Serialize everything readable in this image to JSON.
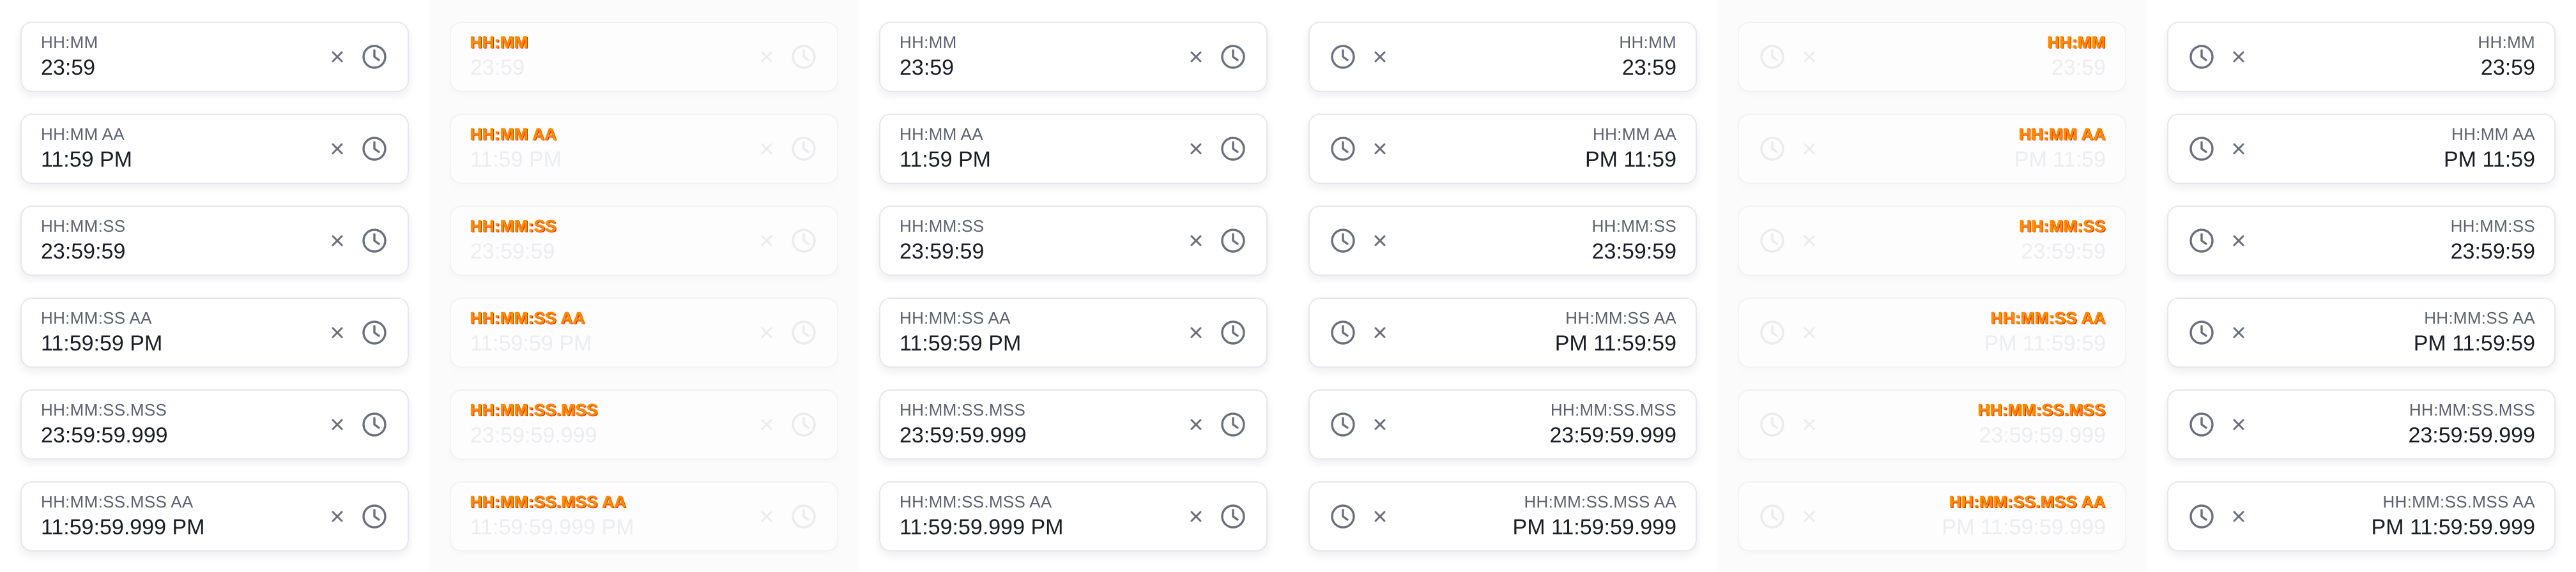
{
  "icons": {
    "clear": "close-icon",
    "time": "clock-icon"
  },
  "colors": {
    "label": "#5d6170",
    "value": "#1b1d26",
    "icon": "#6b6f7d",
    "border": "#e6e7ec",
    "disabled_value": "#ecedf0",
    "disabled_label_glitch": "#ff8c00"
  },
  "columns": [
    {
      "direction": "ltr",
      "state": "enabled",
      "fields": [
        {
          "label": "HH:MM",
          "value": "23:59"
        },
        {
          "label": "HH:MM AA",
          "value": "11:59 PM"
        },
        {
          "label": "HH:MM:SS",
          "value": "23:59:59"
        },
        {
          "label": "HH:MM:SS AA",
          "value": "11:59:59 PM"
        },
        {
          "label": "HH:MM:SS.MSS",
          "value": "23:59:59.999"
        },
        {
          "label": "HH:MM:SS.MSS AA",
          "value": "11:59:59.999 PM"
        }
      ]
    },
    {
      "direction": "ltr",
      "state": "disabled",
      "fields": [
        {
          "label": "HH:MM",
          "value": "23:59"
        },
        {
          "label": "HH:MM AA",
          "value": "11:59 PM"
        },
        {
          "label": "HH:MM:SS",
          "value": "23:59:59"
        },
        {
          "label": "HH:MM:SS AA",
          "value": "11:59:59 PM"
        },
        {
          "label": "HH:MM:SS.MSS",
          "value": "23:59:59.999"
        },
        {
          "label": "HH:MM:SS.MSS AA",
          "value": "11:59:59.999 PM"
        }
      ]
    },
    {
      "direction": "ltr",
      "state": "enabled",
      "fields": [
        {
          "label": "HH:MM",
          "value": "23:59"
        },
        {
          "label": "HH:MM AA",
          "value": "11:59 PM"
        },
        {
          "label": "HH:MM:SS",
          "value": "23:59:59"
        },
        {
          "label": "HH:MM:SS AA",
          "value": "11:59:59 PM"
        },
        {
          "label": "HH:MM:SS.MSS",
          "value": "23:59:59.999"
        },
        {
          "label": "HH:MM:SS.MSS AA",
          "value": "11:59:59.999 PM"
        }
      ]
    },
    {
      "direction": "rtl",
      "state": "enabled",
      "fields": [
        {
          "label": "HH:MM",
          "value": "23:59"
        },
        {
          "label": "HH:MM AA",
          "value": "PM 11:59"
        },
        {
          "label": "HH:MM:SS",
          "value": "23:59:59"
        },
        {
          "label": "HH:MM:SS AA",
          "value": "PM 11:59:59"
        },
        {
          "label": "HH:MM:SS.MSS",
          "value": "23:59:59.999"
        },
        {
          "label": "HH:MM:SS.MSS AA",
          "value": "PM 11:59:59.999"
        }
      ]
    },
    {
      "direction": "rtl",
      "state": "disabled",
      "fields": [
        {
          "label": "HH:MM",
          "value": "23:59"
        },
        {
          "label": "HH:MM AA",
          "value": "PM 11:59"
        },
        {
          "label": "HH:MM:SS",
          "value": "23:59:59"
        },
        {
          "label": "HH:MM:SS AA",
          "value": "PM 11:59:59"
        },
        {
          "label": "HH:MM:SS.MSS",
          "value": "23:59:59.999"
        },
        {
          "label": "HH:MM:SS.MSS AA",
          "value": "PM 11:59:59.999"
        }
      ]
    },
    {
      "direction": "rtl",
      "state": "enabled",
      "fields": [
        {
          "label": "HH:MM",
          "value": "23:59"
        },
        {
          "label": "HH:MM AA",
          "value": "PM 11:59"
        },
        {
          "label": "HH:MM:SS",
          "value": "23:59:59"
        },
        {
          "label": "HH:MM:SS AA",
          "value": "PM 11:59:59"
        },
        {
          "label": "HH:MM:SS.MSS",
          "value": "23:59:59.999"
        },
        {
          "label": "HH:MM:SS.MSS AA",
          "value": "PM 11:59:59.999"
        }
      ]
    }
  ]
}
